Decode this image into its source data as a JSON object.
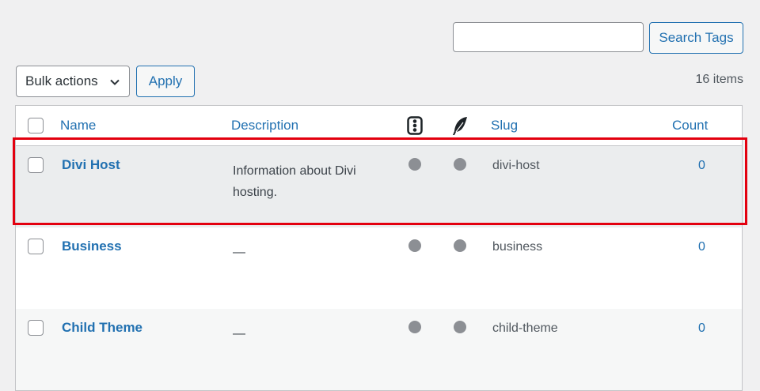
{
  "search": {
    "value": "",
    "placeholder": "",
    "button_label": "Search Tags"
  },
  "bulk": {
    "selected": "Bulk actions",
    "apply_label": "Apply"
  },
  "items_count": "16 items",
  "table": {
    "columns": {
      "name": "Name",
      "description": "Description",
      "slug": "Slug",
      "count": "Count"
    },
    "icons": {
      "col1": "traffic-light-icon",
      "col2": "feather-icon"
    },
    "rows": [
      {
        "name": "Divi Host",
        "description": "Information about Divi hosting.",
        "slug": "divi-host",
        "count": "0",
        "highlighted": true
      },
      {
        "name": "Business",
        "description": "—",
        "slug": "business",
        "count": "0"
      },
      {
        "name": "Child Theme",
        "description": "—",
        "slug": "child-theme",
        "count": "0"
      }
    ]
  },
  "colors": {
    "link": "#2271b1",
    "highlight_border": "#e3000f",
    "dot": "#8c8f94"
  }
}
